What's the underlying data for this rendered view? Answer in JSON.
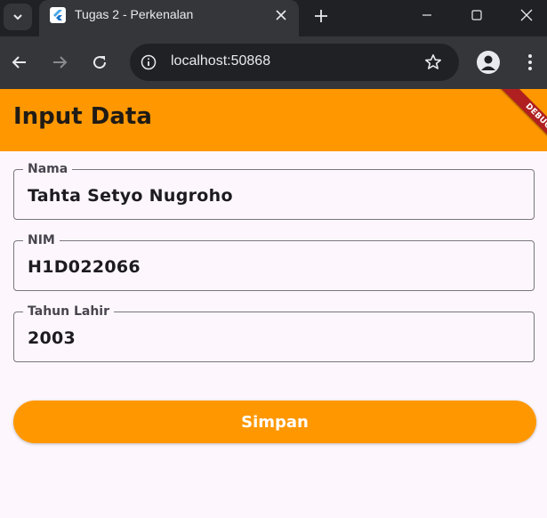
{
  "browser": {
    "tab_title": "Tugas 2 - Perkenalan",
    "url": "localhost:50868",
    "icons": {
      "tab_search": "chevron-down-icon",
      "favicon": "flutter-icon",
      "tab_close": "close-icon",
      "new_tab": "plus-icon",
      "minimize": "minimize-icon",
      "maximize": "maximize-icon",
      "window_close": "close-icon",
      "back": "arrow-left-icon",
      "forward": "arrow-right-icon",
      "reload": "reload-icon",
      "site_info": "info-icon",
      "bookmark": "star-icon",
      "profile": "person-icon",
      "menu": "more-vertical-icon"
    }
  },
  "app": {
    "title": "Input Data",
    "debug_banner": "DEBUG",
    "fields": [
      {
        "label": "Nama",
        "value": "Tahta Setyo Nugroho"
      },
      {
        "label": "NIM",
        "value": "H1D022066"
      },
      {
        "label": "Tahun Lahir",
        "value": "2003"
      }
    ],
    "save_label": "Simpan"
  },
  "colors": {
    "accent": "#ff9800",
    "background": "#fdf7fd",
    "border": "#79747e",
    "debug_banner": "#b02020"
  }
}
